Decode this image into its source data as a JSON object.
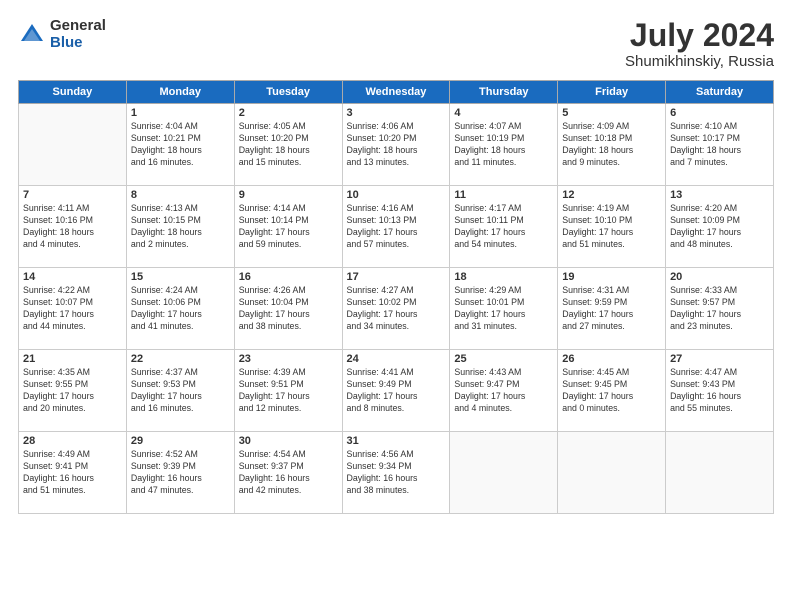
{
  "header": {
    "logo_general": "General",
    "logo_blue": "Blue",
    "month_title": "July 2024",
    "location": "Shumikhinskiy, Russia"
  },
  "days_of_week": [
    "Sunday",
    "Monday",
    "Tuesday",
    "Wednesday",
    "Thursday",
    "Friday",
    "Saturday"
  ],
  "weeks": [
    [
      {
        "date": "",
        "text": ""
      },
      {
        "date": "1",
        "text": "Sunrise: 4:04 AM\nSunset: 10:21 PM\nDaylight: 18 hours\nand 16 minutes."
      },
      {
        "date": "2",
        "text": "Sunrise: 4:05 AM\nSunset: 10:20 PM\nDaylight: 18 hours\nand 15 minutes."
      },
      {
        "date": "3",
        "text": "Sunrise: 4:06 AM\nSunset: 10:20 PM\nDaylight: 18 hours\nand 13 minutes."
      },
      {
        "date": "4",
        "text": "Sunrise: 4:07 AM\nSunset: 10:19 PM\nDaylight: 18 hours\nand 11 minutes."
      },
      {
        "date": "5",
        "text": "Sunrise: 4:09 AM\nSunset: 10:18 PM\nDaylight: 18 hours\nand 9 minutes."
      },
      {
        "date": "6",
        "text": "Sunrise: 4:10 AM\nSunset: 10:17 PM\nDaylight: 18 hours\nand 7 minutes."
      }
    ],
    [
      {
        "date": "7",
        "text": "Sunrise: 4:11 AM\nSunset: 10:16 PM\nDaylight: 18 hours\nand 4 minutes."
      },
      {
        "date": "8",
        "text": "Sunrise: 4:13 AM\nSunset: 10:15 PM\nDaylight: 18 hours\nand 2 minutes."
      },
      {
        "date": "9",
        "text": "Sunrise: 4:14 AM\nSunset: 10:14 PM\nDaylight: 17 hours\nand 59 minutes."
      },
      {
        "date": "10",
        "text": "Sunrise: 4:16 AM\nSunset: 10:13 PM\nDaylight: 17 hours\nand 57 minutes."
      },
      {
        "date": "11",
        "text": "Sunrise: 4:17 AM\nSunset: 10:11 PM\nDaylight: 17 hours\nand 54 minutes."
      },
      {
        "date": "12",
        "text": "Sunrise: 4:19 AM\nSunset: 10:10 PM\nDaylight: 17 hours\nand 51 minutes."
      },
      {
        "date": "13",
        "text": "Sunrise: 4:20 AM\nSunset: 10:09 PM\nDaylight: 17 hours\nand 48 minutes."
      }
    ],
    [
      {
        "date": "14",
        "text": "Sunrise: 4:22 AM\nSunset: 10:07 PM\nDaylight: 17 hours\nand 44 minutes."
      },
      {
        "date": "15",
        "text": "Sunrise: 4:24 AM\nSunset: 10:06 PM\nDaylight: 17 hours\nand 41 minutes."
      },
      {
        "date": "16",
        "text": "Sunrise: 4:26 AM\nSunset: 10:04 PM\nDaylight: 17 hours\nand 38 minutes."
      },
      {
        "date": "17",
        "text": "Sunrise: 4:27 AM\nSunset: 10:02 PM\nDaylight: 17 hours\nand 34 minutes."
      },
      {
        "date": "18",
        "text": "Sunrise: 4:29 AM\nSunset: 10:01 PM\nDaylight: 17 hours\nand 31 minutes."
      },
      {
        "date": "19",
        "text": "Sunrise: 4:31 AM\nSunset: 9:59 PM\nDaylight: 17 hours\nand 27 minutes."
      },
      {
        "date": "20",
        "text": "Sunrise: 4:33 AM\nSunset: 9:57 PM\nDaylight: 17 hours\nand 23 minutes."
      }
    ],
    [
      {
        "date": "21",
        "text": "Sunrise: 4:35 AM\nSunset: 9:55 PM\nDaylight: 17 hours\nand 20 minutes."
      },
      {
        "date": "22",
        "text": "Sunrise: 4:37 AM\nSunset: 9:53 PM\nDaylight: 17 hours\nand 16 minutes."
      },
      {
        "date": "23",
        "text": "Sunrise: 4:39 AM\nSunset: 9:51 PM\nDaylight: 17 hours\nand 12 minutes."
      },
      {
        "date": "24",
        "text": "Sunrise: 4:41 AM\nSunset: 9:49 PM\nDaylight: 17 hours\nand 8 minutes."
      },
      {
        "date": "25",
        "text": "Sunrise: 4:43 AM\nSunset: 9:47 PM\nDaylight: 17 hours\nand 4 minutes."
      },
      {
        "date": "26",
        "text": "Sunrise: 4:45 AM\nSunset: 9:45 PM\nDaylight: 17 hours\nand 0 minutes."
      },
      {
        "date": "27",
        "text": "Sunrise: 4:47 AM\nSunset: 9:43 PM\nDaylight: 16 hours\nand 55 minutes."
      }
    ],
    [
      {
        "date": "28",
        "text": "Sunrise: 4:49 AM\nSunset: 9:41 PM\nDaylight: 16 hours\nand 51 minutes."
      },
      {
        "date": "29",
        "text": "Sunrise: 4:52 AM\nSunset: 9:39 PM\nDaylight: 16 hours\nand 47 minutes."
      },
      {
        "date": "30",
        "text": "Sunrise: 4:54 AM\nSunset: 9:37 PM\nDaylight: 16 hours\nand 42 minutes."
      },
      {
        "date": "31",
        "text": "Sunrise: 4:56 AM\nSunset: 9:34 PM\nDaylight: 16 hours\nand 38 minutes."
      },
      {
        "date": "",
        "text": ""
      },
      {
        "date": "",
        "text": ""
      },
      {
        "date": "",
        "text": ""
      }
    ]
  ]
}
